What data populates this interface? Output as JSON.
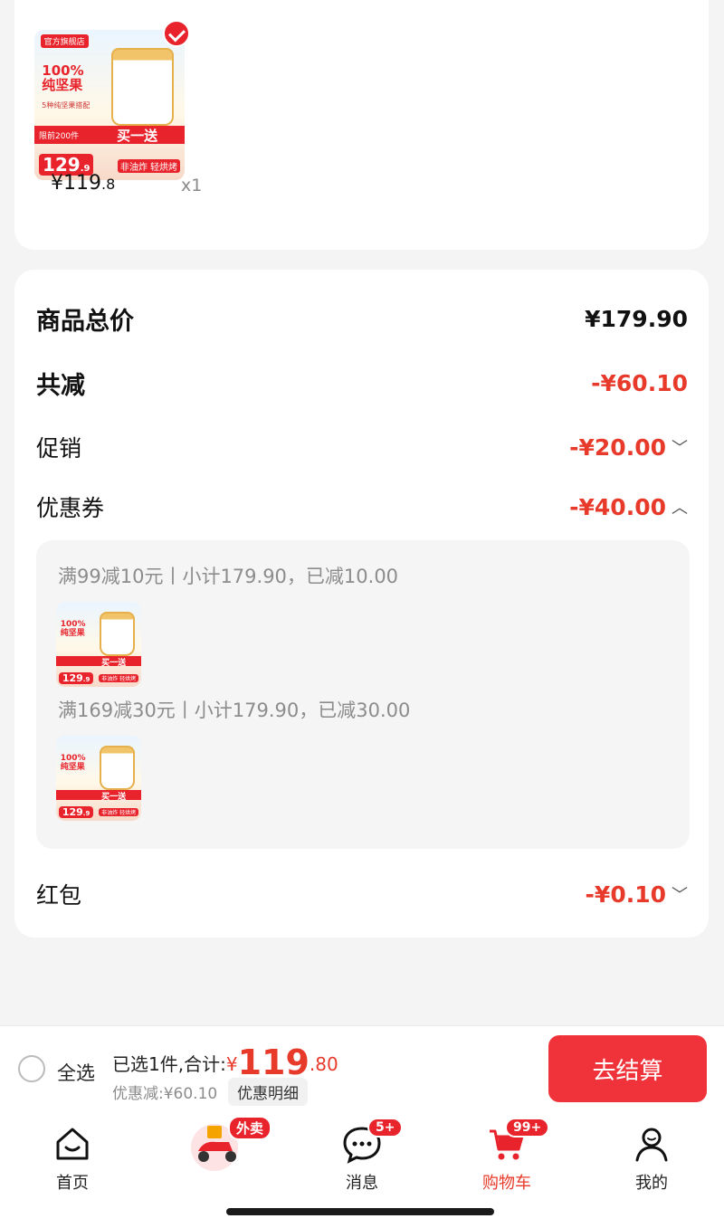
{
  "product": {
    "image_texts": {
      "store_tag": "官方旗舰店",
      "headline_1": "100%",
      "headline_2": "纯坚果",
      "subline": "5种纯坚果搭配",
      "promo_limit": "限前200件",
      "promo": "买一送",
      "image_price": "129",
      "image_price_cents": ".9",
      "footer": "非油炸 轻烘烤"
    },
    "price_int": "¥119",
    "price_dec": ".8",
    "qty": "x1"
  },
  "summary": {
    "total_label": "商品总价",
    "total_value": "¥179.90",
    "reduce_label": "共减",
    "reduce_value": "-¥60.10",
    "promo_label": "促销",
    "promo_value": "-¥20.00",
    "coupon_label": "优惠券",
    "coupon_value": "-¥40.00",
    "redpack_label": "红包",
    "redpack_value": "-¥0.10"
  },
  "coupons": [
    {
      "text": "满99减10元丨小计179.90，已减10.00"
    },
    {
      "text": "满169减30元丨小计179.90，已减30.00"
    }
  ],
  "bottom_bar": {
    "select_all": "全选",
    "selected_prefix": "已选1件,合计:",
    "currency": "¥",
    "total_int": "119",
    "total_dec": ".80",
    "discount": "优惠减:¥60.10",
    "detail_button": "优惠明细",
    "checkout": "去结算"
  },
  "tabbar": {
    "home": "首页",
    "delivery_badge": "外卖",
    "messages": "消息",
    "messages_badge": "5+",
    "cart": "购物车",
    "cart_badge": "99+",
    "mine": "我的"
  },
  "colors": {
    "accent": "#e8232b",
    "price_red": "#e83a2a"
  }
}
